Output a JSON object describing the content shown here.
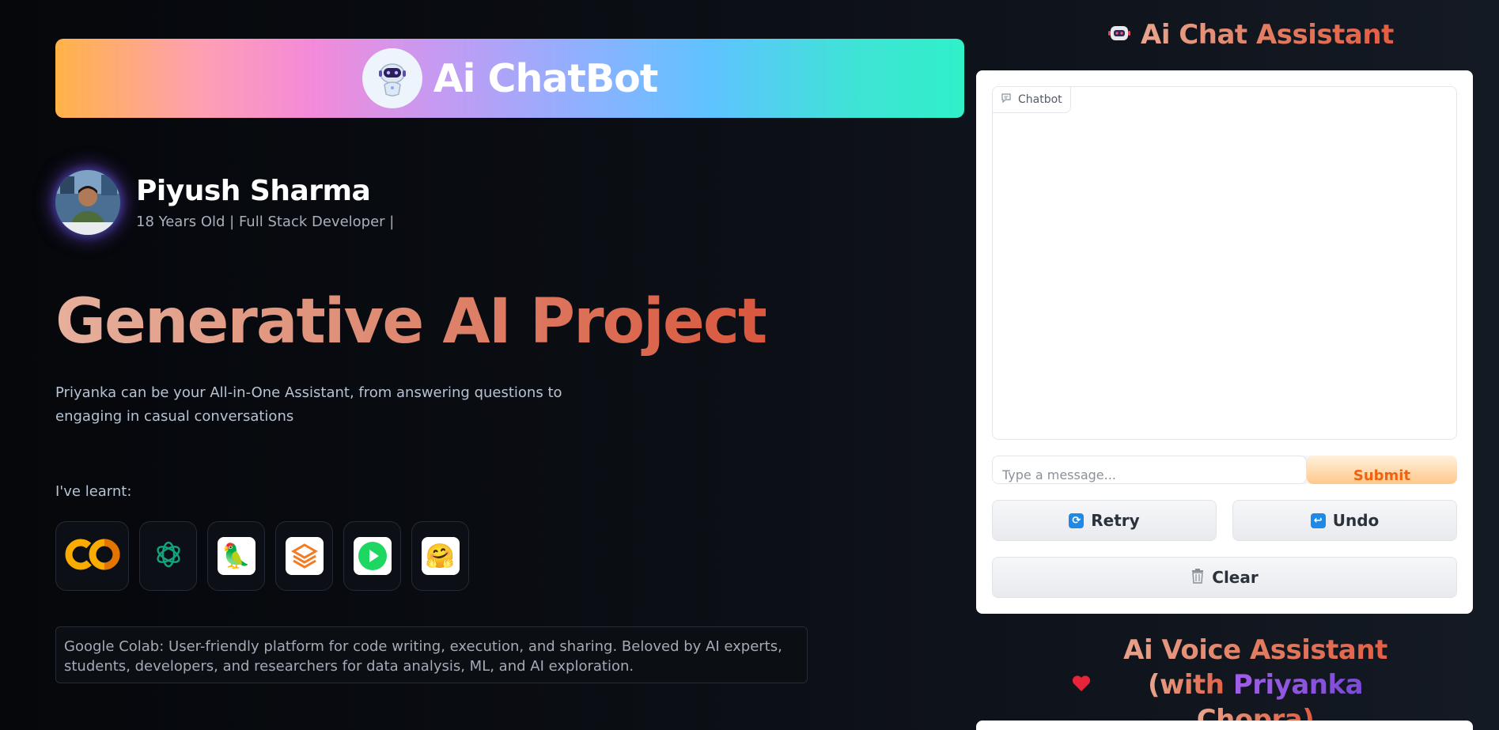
{
  "banner": {
    "title": "Ai ChatBot"
  },
  "profile": {
    "name": "Piyush Sharma",
    "subtitle": "18 Years Old | Full Stack Developer |"
  },
  "hero": {
    "title": "Generative AI Project",
    "description": "Priyanka can be your All-in-One Assistant, from answering questions to engaging in casual conversations"
  },
  "learnt": {
    "label": "I've learnt:",
    "tools": [
      {
        "icon": "google-colab-icon"
      },
      {
        "icon": "openai-icon"
      },
      {
        "icon": "langchain-icon"
      },
      {
        "icon": "tool-layers-icon"
      },
      {
        "icon": "play-icon"
      },
      {
        "icon": "huggingface-icon"
      }
    ],
    "selected_description": "Google Colab: User-friendly platform for code writing, execution, and sharing. Beloved by AI experts, students, developers, and researchers for data analysis, ML, and AI exploration."
  },
  "chat": {
    "heading": "Ai Chat Assistant",
    "chatbot_label": "Chatbot",
    "input_placeholder": "Type a message...",
    "submit_label": "Submit",
    "retry_label": "Retry",
    "undo_label": "Undo",
    "clear_label": "Clear"
  },
  "voice": {
    "heading_line1": "Ai Voice Assistant",
    "heading_line2_prefix": "(with ",
    "heading_line2_name": "Priyanka",
    "heading_line2_suffix": " Chopra)"
  },
  "colors": {
    "accent_orange": "#e45c42",
    "submit_text": "#f0620f",
    "purple": "#8a50de"
  }
}
